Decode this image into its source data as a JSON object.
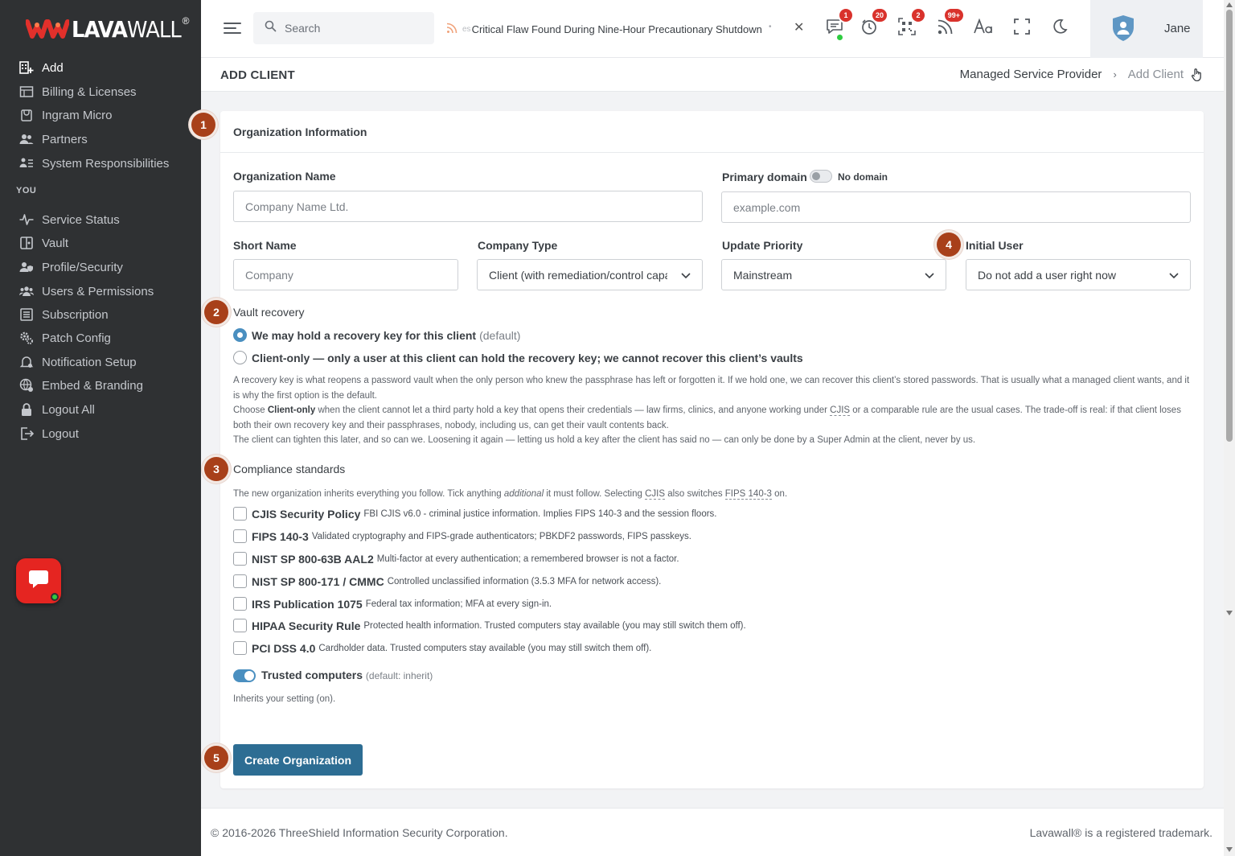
{
  "brand": {
    "name_bold": "LAVA",
    "name_light": "WALL",
    "reg": "®"
  },
  "sidebar": {
    "items": [
      {
        "label": "Add",
        "icon": "building-add-icon",
        "active": true
      },
      {
        "label": "Billing & Licenses",
        "icon": "billing-icon"
      },
      {
        "label": "Ingram Micro",
        "icon": "store-icon"
      },
      {
        "label": "Partners",
        "icon": "partners-icon"
      },
      {
        "label": "System Responsibilities",
        "icon": "responsibilities-icon"
      }
    ],
    "section_label": "YOU",
    "you_items": [
      {
        "label": "Service Status",
        "icon": "pulse-icon"
      },
      {
        "label": "Vault",
        "icon": "vault-icon"
      },
      {
        "label": "Profile/Security",
        "icon": "user-shield-icon"
      },
      {
        "label": "Users & Permissions",
        "icon": "users-icon"
      },
      {
        "label": "Subscription",
        "icon": "list-icon"
      },
      {
        "label": "Patch Config",
        "icon": "gears-icon"
      },
      {
        "label": "Notification Setup",
        "icon": "bell-icon"
      },
      {
        "label": "Embed & Branding",
        "icon": "globe-icon"
      },
      {
        "label": "Logout All",
        "icon": "lock-icon"
      },
      {
        "label": "Logout",
        "icon": "logout-icon"
      }
    ]
  },
  "topbar": {
    "search_placeholder": "Search",
    "ticker_prefix": "es",
    "ticker_text": "Critical Flaw Found During Nine-Hour Precautionary Shutdown",
    "badges": {
      "messages": "1",
      "timer": "20",
      "qr": "2",
      "feeds": "99+"
    },
    "user_name": "Jane",
    "accent": "#d9322c"
  },
  "page": {
    "title": "ADD CLIENT",
    "breadcrumb": [
      "Managed Service Provider",
      "Add Client"
    ]
  },
  "form": {
    "section_title": "Organization Information",
    "org_name_label": "Organization Name",
    "org_name_placeholder": "Company Name Ltd.",
    "primary_domain_label": "Primary domain",
    "no_domain_label": "No domain",
    "domain_placeholder": "example.com",
    "short_name_label": "Short Name",
    "short_name_placeholder": "Company",
    "company_type_label": "Company Type",
    "company_type_value": "Client (with remediation/control capabilities)",
    "update_priority_label": "Update Priority",
    "update_priority_value": "Mainstream",
    "initial_user_label": "Initial User",
    "initial_user_value": "Do not add a user right now",
    "vault_label": "Vault recovery",
    "vault_opt1": "We may hold a recovery key for this client",
    "vault_opt1_suffix": "(default)",
    "vault_opt2": "Client-only — only a user at this client can hold the recovery key; we cannot recover this client’s vaults",
    "vault_help1": "A recovery key is what reopens a password vault when the only person who knew the passphrase has left or forgotten it. If we hold one, we can recover this client’s stored passwords. That is usually what a managed client wants, and it is why the first option is the default.",
    "vault_help2a": "Choose",
    "vault_help2b": "Client-only",
    "vault_help2c": "when the client cannot let a third party hold a key that opens their credentials — law firms, clinics, and anyone working under",
    "vault_help2d": "CJIS",
    "vault_help2e": "or a comparable rule are the usual cases. The trade-off is real: if that client loses both their own recovery key and their passphrases, nobody, including us, can get their vault contents back.",
    "vault_help3": "The client can tighten this later, and so can we. Loosening it again — letting us hold a key after the client has said no — can only be done by a Super Admin at the client, never by us.",
    "compliance_label": "Compliance standards",
    "compliance_help_a": "The new organization inherits everything you follow. Tick anything",
    "compliance_help_b": "additional",
    "compliance_help_c": "it must follow. Selecting",
    "compliance_help_d": "CJIS",
    "compliance_help_e": "also switches",
    "compliance_help_f": "FIPS 140-3",
    "compliance_help_g": "on.",
    "standards": [
      {
        "name": "CJIS Security Policy",
        "desc": "FBI CJIS v6.0 - criminal justice information. Implies FIPS 140-3 and the session floors."
      },
      {
        "name": "FIPS 140-3",
        "desc": "Validated cryptography and FIPS-grade authenticators; PBKDF2 passwords, FIPS passkeys."
      },
      {
        "name": "NIST SP 800-63B AAL2",
        "desc": "Multi-factor at every authentication; a remembered browser is not a factor."
      },
      {
        "name": "NIST SP 800-171 / CMMC",
        "desc": "Controlled unclassified information (3.5.3 MFA for network access)."
      },
      {
        "name": "IRS Publication 1075",
        "desc": "Federal tax information; MFA at every sign-in."
      },
      {
        "name": "HIPAA Security Rule",
        "desc": "Protected health information. Trusted computers stay available (you may still switch them off)."
      },
      {
        "name": "PCI DSS 4.0",
        "desc": "Cardholder data. Trusted computers stay available (you may still switch them off)."
      }
    ],
    "trusted_label": "Trusted computers",
    "trusted_suffix": "(default: inherit)",
    "trusted_help": "Inherits your setting (on).",
    "submit_label": "Create Organization",
    "steps": [
      "1",
      "2",
      "3",
      "4",
      "5"
    ]
  },
  "footer": {
    "copyright": "© 2016-2026 ThreeShield Information Security Corporation.",
    "trademark": "Lavawall® is a registered trademark."
  }
}
